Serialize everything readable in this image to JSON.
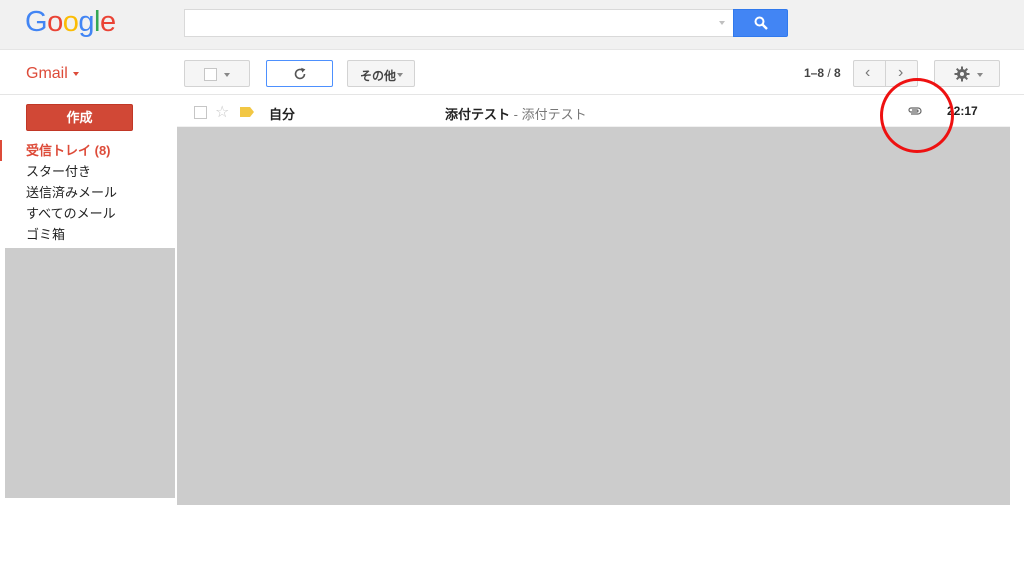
{
  "header": {
    "logo_letters": [
      {
        "ch": "G",
        "color": "#4285f4"
      },
      {
        "ch": "o",
        "color": "#ea4335"
      },
      {
        "ch": "o",
        "color": "#fbbc05"
      },
      {
        "ch": "g",
        "color": "#4285f4"
      },
      {
        "ch": "l",
        "color": "#34a853"
      },
      {
        "ch": "e",
        "color": "#ea4335"
      }
    ],
    "search_placeholder": "",
    "search_icon": "search-icon"
  },
  "toolbar": {
    "app_label": "Gmail",
    "more_label": "その他",
    "page_range": "1–8",
    "page_sep": " / ",
    "page_total": "8"
  },
  "sidebar": {
    "compose_label": "作成",
    "items": [
      {
        "label": "受信トレイ (8)",
        "active": true
      },
      {
        "label": "スター付き",
        "active": false
      },
      {
        "label": "送信済みメール",
        "active": false
      },
      {
        "label": "すべてのメール",
        "active": false
      },
      {
        "label": "ゴミ箱",
        "active": false
      }
    ]
  },
  "messages": [
    {
      "sender": "自分",
      "subject": "添付テスト",
      "snippet": " - 添付テスト",
      "time": "22:17",
      "has_attachment": true,
      "important_marker": true
    }
  ],
  "colors": {
    "accent_red": "#dd4b39",
    "compose_red": "#d14836",
    "search_blue": "#4285f4",
    "annotation_red": "#ee1111"
  }
}
